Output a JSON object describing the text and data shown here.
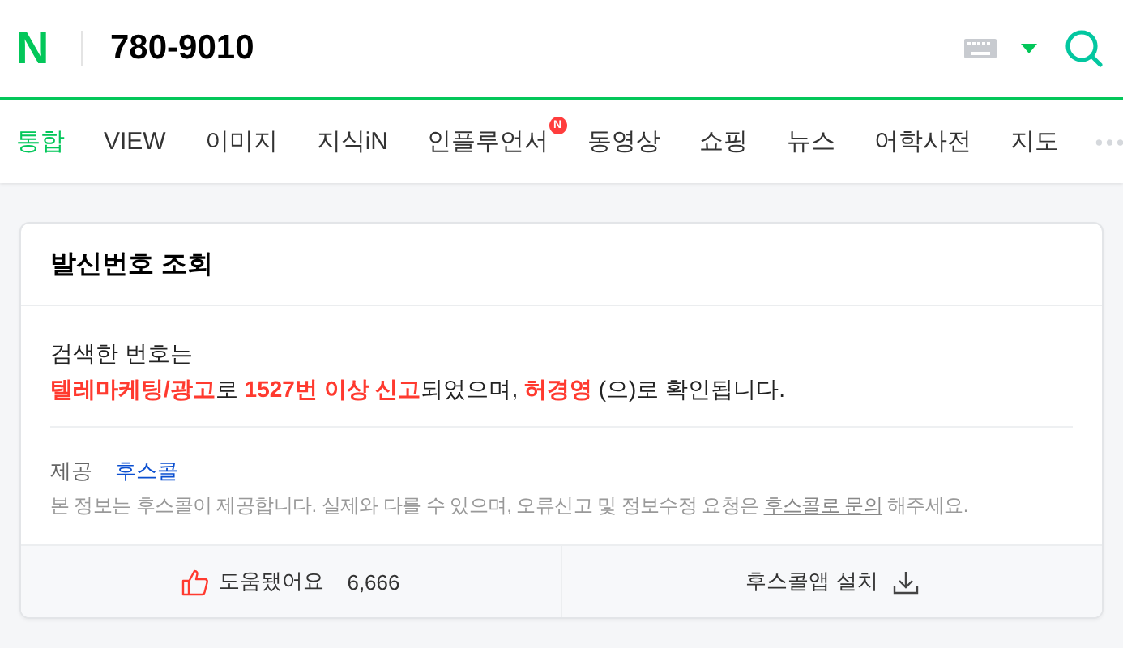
{
  "header": {
    "logo": "N",
    "query": "780-9010"
  },
  "tabs": [
    {
      "label": "통합",
      "selected": true
    },
    {
      "label": "VIEW",
      "selected": false
    },
    {
      "label": "이미지",
      "selected": false
    },
    {
      "label": "지식iN",
      "selected": false
    },
    {
      "label": "인플루언서",
      "selected": false,
      "badge": "N"
    },
    {
      "label": "동영상",
      "selected": false
    },
    {
      "label": "쇼핑",
      "selected": false
    },
    {
      "label": "뉴스",
      "selected": false
    },
    {
      "label": "어학사전",
      "selected": false
    },
    {
      "label": "지도",
      "selected": false
    }
  ],
  "card": {
    "title": "발신번호 조회",
    "intro": "검색한 번호는",
    "result": "**텔레마케팅/광고**로 **1527번 이상 신고**되었으며, **허경영** (으)로 확인됩니다.",
    "provider_label": "제공",
    "provider": "후스콜",
    "notice_before": "본 정보는 후스콜이 제공합니다. 실제와 다를 수 있으며, 오류신고 및 정보수정 요청은 ",
    "notice_link": "후스콜로 문의",
    "notice_after": " 해주세요.",
    "helpful_label": "도움됐어요",
    "helpful_count": "6,666",
    "install_label": "후스콜앱 설치"
  }
}
